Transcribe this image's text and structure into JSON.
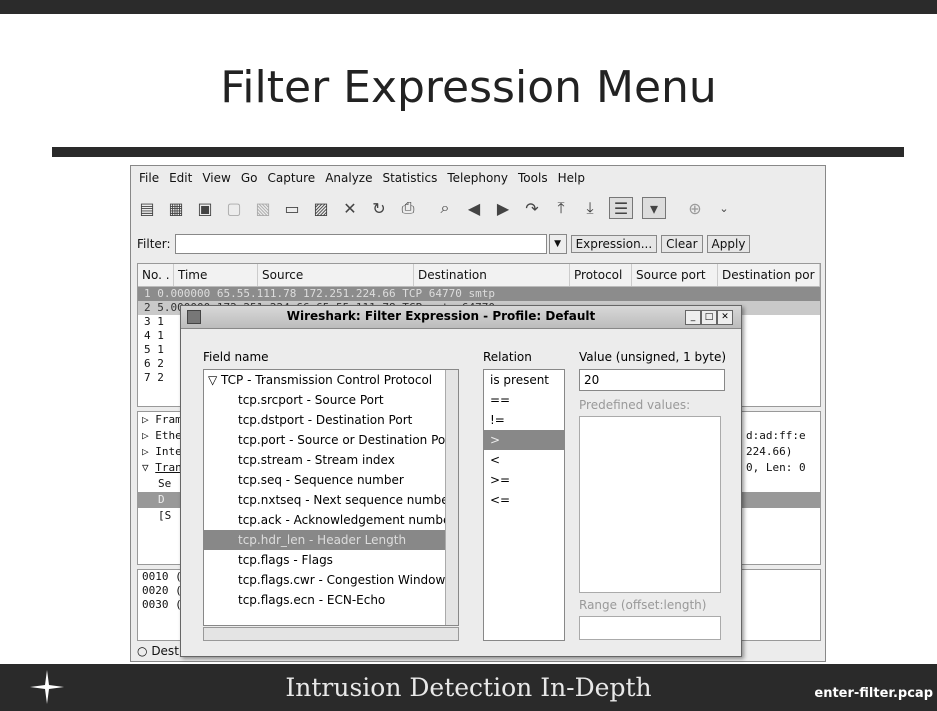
{
  "slide": {
    "title": "Filter Expression Menu",
    "footer": "Intrusion Detection In-Depth",
    "footer_file": "enter-filter.pcap"
  },
  "menubar": [
    "File",
    "Edit",
    "View",
    "Go",
    "Capture",
    "Analyze",
    "Statistics",
    "Telephony",
    "Tools",
    "Help"
  ],
  "toolbar_icons": [
    "interface-list-icon",
    "capture-options-icon",
    "start-capture-icon",
    "stop-capture-icon",
    "restart-capture-icon",
    "open-file-icon",
    "save-file-icon",
    "close-file-icon",
    "reload-icon",
    "print-icon",
    "find-icon",
    "back-icon",
    "forward-icon",
    "goto-packet-icon",
    "first-packet-icon",
    "last-packet-icon",
    "colorize-icon",
    "autoscroll-icon",
    "zoom-in-icon"
  ],
  "filterbar": {
    "label": "Filter:",
    "value": "",
    "expression_label": "Expression...",
    "clear_label": "Clear",
    "apply_label": "Apply"
  },
  "packet_list": {
    "columns": [
      "No. .",
      "Time",
      "Source",
      "Destination",
      "Protocol",
      "Source port",
      "Destination por"
    ],
    "rows": [
      "1 0.000000   65.55.111.78        172.251.224.66       TCP        64770        smtp",
      "2 5.000000   172.251.224.66      65.55.111.78         TCP        smtp        64770",
      "3 1",
      "4 1",
      "5 1",
      "6 2",
      "7 2"
    ]
  },
  "details": [
    "Fram",
    "Ethe",
    "Inte",
    "Tran",
    "Se",
    "D",
    "[S"
  ],
  "details_right": [
    "d:ad:ff:e",
    "224.66)",
    "0, Len: 0"
  ],
  "hex": [
    "0010  (",
    "0020  (",
    "0030  ("
  ],
  "status": "Dest",
  "dialog": {
    "title": "Wireshark: Filter Expression - Profile: Default",
    "field_name_label": "Field name",
    "relation_label": "Relation",
    "value_label": "Value (unsigned, 1 byte)",
    "value": "20",
    "predefined_label": "Predefined values:",
    "range_label": "Range (offset:length)",
    "fields": [
      "TCP - Transmission Control Protocol",
      "tcp.srcport - Source Port",
      "tcp.dstport - Destination Port",
      "tcp.port - Source or Destination Port",
      "tcp.stream - Stream index",
      "tcp.seq - Sequence number",
      "tcp.nxtseq - Next sequence number",
      "tcp.ack - Acknowledgement number",
      "tcp.hdr_len - Header Length",
      "tcp.flags - Flags",
      "tcp.flags.cwr - Congestion Window Re",
      "tcp.flags.ecn - ECN-Echo"
    ],
    "relations": [
      "is present",
      "==",
      "!=",
      ">",
      "<",
      ">=",
      "<="
    ]
  }
}
